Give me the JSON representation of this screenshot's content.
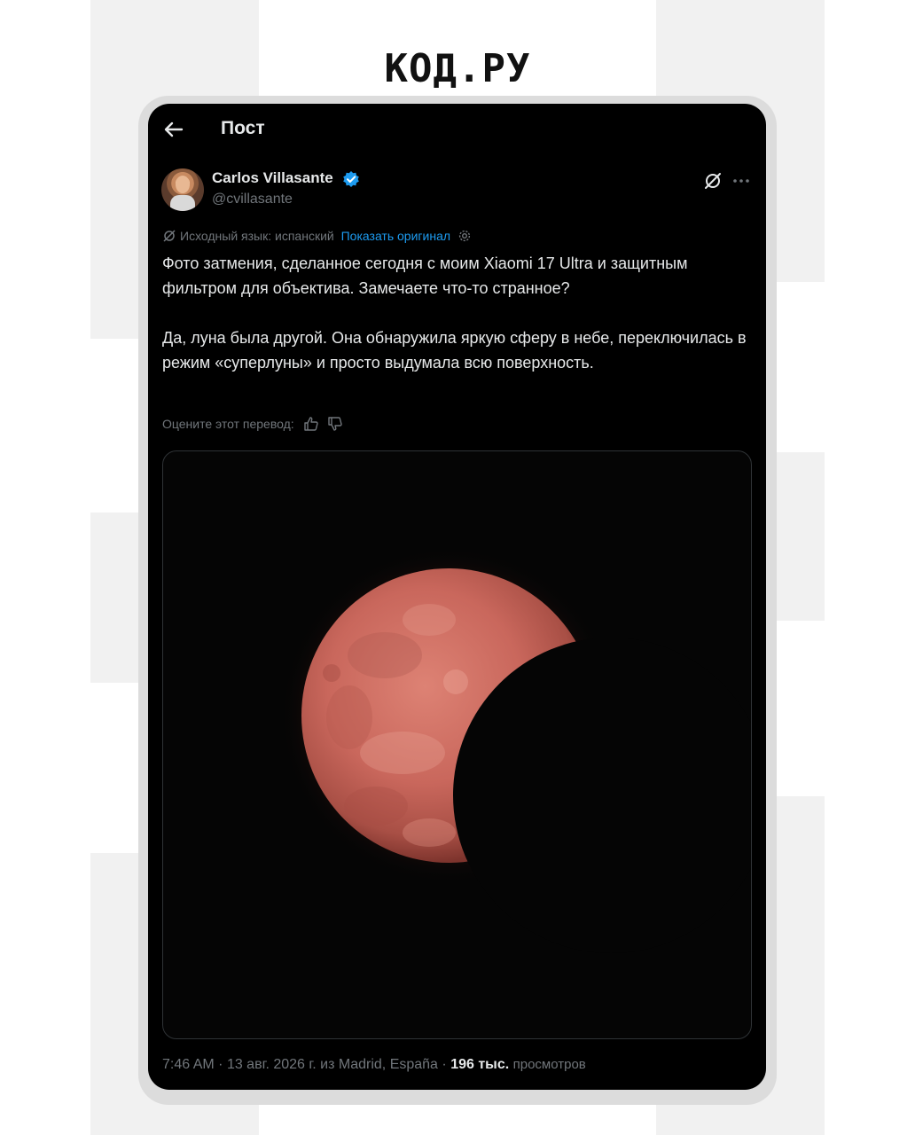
{
  "brand": {
    "logo_text": "КОД.РУ"
  },
  "header": {
    "title": "Пост",
    "back_icon": "arrow-left-icon"
  },
  "author": {
    "name": "Carlos Villasante",
    "handle": "@cvillasante",
    "verified": true,
    "verified_color": "#1d9bf0"
  },
  "translation": {
    "source_language_label": "Исходный язык: испанский",
    "show_original_label": "Показать оригинал",
    "rate_label": "Оцените этот перевод:"
  },
  "post": {
    "paragraph_1": "Фото затмения, сделанное сегодня с моим Xiaomi 17 Ultra и защитным фильтром для объектива. Замечаете что-то странное?",
    "paragraph_2": "Да, луна была другой. Она обнаружила яркую сферу в небе, переключилась в режим «суперлуны» и просто выдумала всю поверхность."
  },
  "meta": {
    "time": "7:46 AM",
    "date": "13 авг. 2026 г.",
    "location": "из Madrid, España",
    "views_count": "196 тыс.",
    "views_label": "просмотров"
  },
  "colors": {
    "background": "#000000",
    "text": "#e7e9ea",
    "secondary": "#71767b",
    "link": "#1d9bf0",
    "moon": "#c9675c"
  }
}
